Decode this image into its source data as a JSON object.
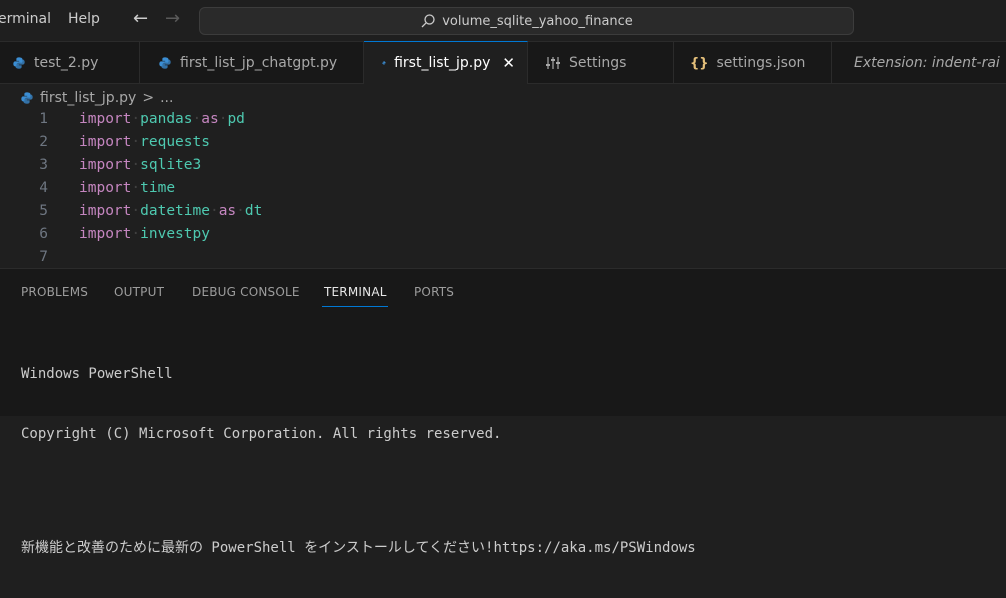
{
  "titlebar": {
    "menu": [
      "erminal",
      "Help"
    ],
    "back_arrow": "←",
    "forward_arrow": "→",
    "search_text": "volume_sqlite_yahoo_finance"
  },
  "tabs": [
    {
      "label": "test_2.py",
      "icon": "python-icon"
    },
    {
      "label": "first_list_jp_chatgpt.py",
      "icon": "python-icon"
    },
    {
      "label": "first_list_jp.py",
      "icon": "python-icon",
      "active": true
    },
    {
      "label": "Settings",
      "icon": "settings-sliders-icon"
    },
    {
      "label": "settings.json",
      "icon": "json-braces-icon"
    },
    {
      "label": "Extension: indent-rai",
      "icon": "extensions-icon"
    }
  ],
  "breadcrumb": {
    "file": "first_list_jp.py",
    "separator": ">",
    "more": "..."
  },
  "editor": {
    "lines": [
      {
        "num": "1",
        "kw": "import",
        "mod": "pandas",
        "as": "as",
        "alias": "pd"
      },
      {
        "num": "2",
        "kw": "import",
        "mod": "requests"
      },
      {
        "num": "3",
        "kw": "import",
        "mod": "sqlite3"
      },
      {
        "num": "4",
        "kw": "import",
        "mod": "time"
      },
      {
        "num": "5",
        "kw": "import",
        "mod": "datetime",
        "as": "as",
        "alias": "dt"
      },
      {
        "num": "6",
        "kw": "import",
        "mod": "investpy"
      },
      {
        "num": "7"
      }
    ]
  },
  "panel": {
    "tabs": [
      "PROBLEMS",
      "OUTPUT",
      "DEBUG CONSOLE",
      "TERMINAL",
      "PORTS"
    ],
    "active_tab": "TERMINAL",
    "terminal_lines": [
      "Windows PowerShell",
      "Copyright (C) Microsoft Corporation. All rights reserved.",
      "",
      "新機能と改善のために最新の PowerShell をインストールしてください!https://aka.ms/PSWindows"
    ]
  },
  "colors": {
    "accent": "#0078d4",
    "keyword": "#c586c0",
    "module": "#4ec9b0",
    "python_blue": "#3b8ed4",
    "json_yellow": "#e5c07b"
  }
}
